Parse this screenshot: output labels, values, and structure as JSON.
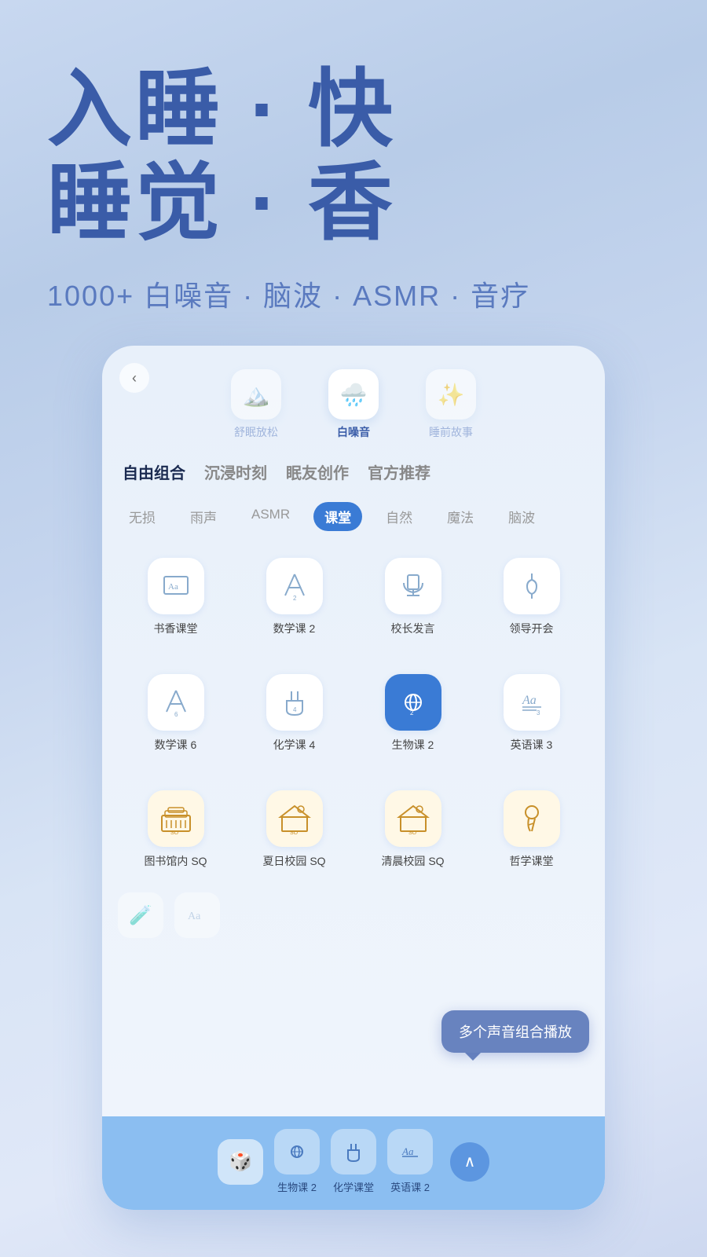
{
  "hero": {
    "line1": "入睡 · 快",
    "line2": "睡觉 · 香",
    "subtitle": "1000+ 白噪音 · 脑波 · ASMR · 音疗"
  },
  "phone": {
    "back_label": "‹",
    "tabs": [
      {
        "label": "舒眠放松",
        "icon": "🏔️",
        "active": false
      },
      {
        "label": "白噪音",
        "icon": "🌧️",
        "active": true
      },
      {
        "label": "睡前故事",
        "icon": "✨",
        "active": false
      }
    ],
    "category_tabs": [
      {
        "label": "自由组合",
        "active": true
      },
      {
        "label": "沉浸时刻",
        "active": false
      },
      {
        "label": "眠友创作",
        "active": false
      },
      {
        "label": "官方推荐",
        "active": false
      }
    ],
    "sub_tabs": [
      {
        "label": "无损",
        "active": false
      },
      {
        "label": "雨声",
        "active": false
      },
      {
        "label": "ASMR",
        "active": false
      },
      {
        "label": "课堂",
        "active": true
      },
      {
        "label": "自然",
        "active": false
      },
      {
        "label": "魔法",
        "active": false
      },
      {
        "label": "脑波",
        "active": false
      }
    ],
    "sounds_row1": [
      {
        "label": "书香课堂",
        "icon": "📖",
        "type": "normal"
      },
      {
        "label": "数学课 2",
        "icon": "📐",
        "type": "normal"
      },
      {
        "label": "校长发言",
        "icon": "🎙️",
        "type": "normal"
      },
      {
        "label": "领导开会",
        "icon": "👔",
        "type": "normal"
      }
    ],
    "sounds_row2": [
      {
        "label": "数学课 6",
        "icon": "📐",
        "type": "normal"
      },
      {
        "label": "化学课 4",
        "icon": "🧪",
        "type": "normal"
      },
      {
        "label": "生物课 2",
        "icon": "🔬",
        "type": "active"
      },
      {
        "label": "英语课 3",
        "icon": "📝",
        "type": "normal"
      }
    ],
    "sounds_row3": [
      {
        "label": "图书馆内 SQ",
        "icon": "🏛️",
        "type": "gold"
      },
      {
        "label": "夏日校园 SQ",
        "icon": "🏫",
        "type": "gold"
      },
      {
        "label": "清晨校园 SQ",
        "icon": "🏫",
        "type": "gold"
      },
      {
        "label": "哲学课堂",
        "icon": "🤔",
        "type": "gold"
      }
    ],
    "tooltip": "多个声音组合播放",
    "player_items": [
      {
        "label": "",
        "icon": "🎲",
        "type": "dice"
      },
      {
        "label": "生物课 2",
        "icon": "🔬",
        "type": "normal"
      },
      {
        "label": "化学课堂",
        "icon": "🧪",
        "type": "normal"
      },
      {
        "label": "英语课 2",
        "icon": "📝",
        "type": "normal"
      }
    ],
    "player_up_icon": "∧"
  }
}
